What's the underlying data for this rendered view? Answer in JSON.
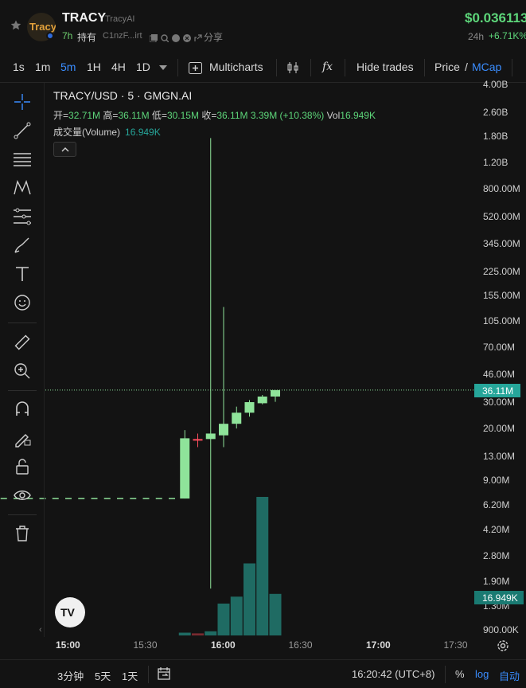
{
  "header": {
    "token_symbol": "TRACY",
    "token_name": "TracyAI",
    "avatar_text": "Tracy",
    "age": "7h",
    "holders_label": "持有",
    "address": "C1nzF...irt",
    "share_label": "分享",
    "price": "$0.036113",
    "change_period": "24h",
    "change_value": "+6.71K%"
  },
  "toolbar": {
    "intervals": [
      "1s",
      "1m",
      "5m",
      "1H",
      "4H",
      "1D"
    ],
    "active_interval": "5m",
    "multicharts_label": "Multicharts",
    "fx_label": "fx",
    "hide_trades_label": "Hide trades",
    "price_label": "Price",
    "slash": "/",
    "mcap_label": "MCap"
  },
  "legend": {
    "title": "TRACY/USD · 5 · GMGN.AI",
    "open_label": "开",
    "open": "32.71M",
    "high_label": "高",
    "high": "36.11M",
    "low_label": "低",
    "low": "30.15M",
    "close_label": "收",
    "close": "36.11M",
    "change": "3.39M (+10.38%)",
    "vol_label": "Vol",
    "vol": "16.949K",
    "volume_study": "成交量(Volume)",
    "volume_value": "16.949K"
  },
  "price_axis": {
    "ticks": [
      "4.00B",
      "2.60B",
      "1.80B",
      "1.20B",
      "800.00M",
      "520.00M",
      "345.00M",
      "225.00M",
      "155.00M",
      "105.00M",
      "70.00M",
      "46.00M",
      "30.00M",
      "20.00M",
      "13.00M",
      "9.00M",
      "6.20M",
      "4.20M",
      "2.80M",
      "1.90M",
      "1.30M",
      "900.00K"
    ],
    "current_price_tag": "36.11M",
    "current_volume_tag": "16.949K"
  },
  "time_axis": {
    "labels": [
      "15:00",
      "15:30",
      "16:00",
      "16:30",
      "17:00",
      "17:30"
    ],
    "bold": [
      "15:00",
      "16:00",
      "17:00"
    ]
  },
  "bottom_bar": {
    "range_3d": "3分钟",
    "range_5d": "5天",
    "range_1d": "1天",
    "clock": "16:20:42 (UTC+8)",
    "percent": "%",
    "log": "log",
    "auto": "自动"
  },
  "colors": {
    "up": "#8fe39a",
    "down": "#ff4d5e",
    "volume": "#1f6b63",
    "accent": "#3a8dff"
  },
  "chart_data": {
    "type": "candlestick",
    "title": "TRACY/USD · 5 · GMGN.AI",
    "scale": "log",
    "ylim_market_cap": [
      900000,
      4000000000
    ],
    "x": [
      "14:35",
      "14:40",
      "14:45",
      "14:50",
      "14:55",
      "15:00",
      "15:05",
      "15:10",
      "15:15",
      "15:20",
      "15:25",
      "15:30",
      "15:35",
      "15:40",
      "15:45",
      "15:50",
      "15:55",
      "16:00",
      "16:05",
      "16:10",
      "16:15",
      "16:20"
    ],
    "candles": [
      {
        "t": "14:35",
        "o": 6800000.0,
        "h": 6800000.0,
        "l": 6800000.0,
        "c": 6800000.0
      },
      {
        "t": "14:40",
        "o": 6800000.0,
        "h": 6800000.0,
        "l": 6800000.0,
        "c": 6800000.0
      },
      {
        "t": "14:45",
        "o": 6800000.0,
        "h": 6800000.0,
        "l": 6800000.0,
        "c": 6800000.0
      },
      {
        "t": "14:50",
        "o": 6800000.0,
        "h": 6800000.0,
        "l": 6800000.0,
        "c": 6800000.0
      },
      {
        "t": "14:55",
        "o": 6800000.0,
        "h": 6800000.0,
        "l": 6800000.0,
        "c": 6800000.0
      },
      {
        "t": "15:00",
        "o": 6800000.0,
        "h": 6800000.0,
        "l": 6800000.0,
        "c": 6800000.0
      },
      {
        "t": "15:05",
        "o": 6800000.0,
        "h": 6800000.0,
        "l": 6800000.0,
        "c": 6800000.0
      },
      {
        "t": "15:10",
        "o": 6800000.0,
        "h": 6800000.0,
        "l": 6800000.0,
        "c": 6800000.0
      },
      {
        "t": "15:15",
        "o": 6800000.0,
        "h": 6800000.0,
        "l": 6800000.0,
        "c": 6800000.0
      },
      {
        "t": "15:20",
        "o": 6800000.0,
        "h": 6800000.0,
        "l": 6800000.0,
        "c": 6800000.0
      },
      {
        "t": "15:25",
        "o": 6800000.0,
        "h": 6800000.0,
        "l": 6800000.0,
        "c": 6800000.0
      },
      {
        "t": "15:30",
        "o": 6800000.0,
        "h": 6800000.0,
        "l": 6800000.0,
        "c": 6800000.0
      },
      {
        "t": "15:35",
        "o": 6800000.0,
        "h": 6800000.0,
        "l": 6800000.0,
        "c": 6800000.0
      },
      {
        "t": "15:40",
        "o": 6800000.0,
        "h": 6800000.0,
        "l": 6800000.0,
        "c": 6800000.0
      },
      {
        "t": "15:45",
        "o": 6800000.0,
        "h": 19500000.0,
        "l": 6800000.0,
        "c": 17200000.0
      },
      {
        "t": "15:50",
        "o": 17000000.0,
        "h": 18500000.0,
        "l": 15000000.0,
        "c": 16900000.0
      },
      {
        "t": "15:55",
        "o": 17000000.0,
        "h": 1750000000.0,
        "l": 1700000.0,
        "c": 18500000.0
      },
      {
        "t": "16:00",
        "o": 18000000.0,
        "h": 130000000.0,
        "l": 15000000.0,
        "c": 21500000.0
      },
      {
        "t": "16:05",
        "o": 21500000.0,
        "h": 28000000.0,
        "l": 20000000.0,
        "c": 25500000.0
      },
      {
        "t": "16:10",
        "o": 25500000.0,
        "h": 31000000.0,
        "l": 24000000.0,
        "c": 30000000.0
      },
      {
        "t": "16:15",
        "o": 29500000.0,
        "h": 33500000.0,
        "l": 29000000.0,
        "c": 32700000.0
      },
      {
        "t": "16:20",
        "o": 32710000.0,
        "h": 36110000.0,
        "l": 30150000.0,
        "c": 36110000.0
      }
    ],
    "volume": {
      "name": "成交量(Volume)",
      "x": [
        "15:45",
        "15:50",
        "15:55",
        "16:00",
        "16:05",
        "16:10",
        "16:15",
        "16:20"
      ],
      "values": [
        0.2,
        0.15,
        0.3,
        2.3,
        2.8,
        5.2,
        10.0,
        3.0
      ],
      "unit": "relative"
    }
  }
}
